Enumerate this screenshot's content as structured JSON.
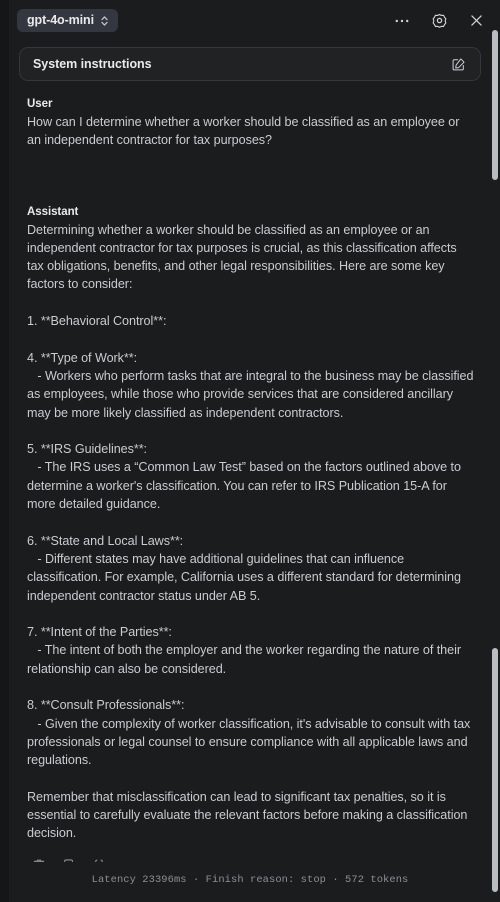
{
  "topbar": {
    "model": "gpt-4o-mini",
    "model_chip_icon": "chevron-updown-icon",
    "more_icon": "ellipsis-icon",
    "settings_icon": "gear-icon",
    "close_icon": "close-icon"
  },
  "system_instructions": {
    "label": "System instructions",
    "edit_icon": "edit-pencil-square-icon"
  },
  "conversation": {
    "user": {
      "role_label": "User",
      "text": "How can I determine whether a worker should be classified as an employee or an independent contractor for tax purposes?"
    },
    "assistant": {
      "role_label": "Assistant",
      "text": "Determining whether a worker should be classified as an employee or an independent contractor for tax purposes is crucial, as this classification affects tax obligations, benefits, and other legal responsibilities. Here are some key factors to consider:\n\n1. **Behavioral Control**:\n\n4. **Type of Work**:\n   - Workers who perform tasks that are integral to the business may be classified as employees, while those who provide services that are considered ancillary may be more likely classified as independent contractors.\n\n5. **IRS Guidelines**:\n   - The IRS uses a “Common Law Test” based on the factors outlined above to determine a worker's classification. You can refer to IRS Publication 15-A for more detailed guidance.\n\n6. **State and Local Laws**:\n   - Different states may have additional guidelines that can influence classification. For example, California uses a different standard for determining independent contractor status under AB 5.\n\n7. **Intent of the Parties**:\n   - The intent of both the employer and the worker regarding the nature of their relationship can also be considered.\n\n8. **Consult Professionals**:\n   - Given the complexity of worker classification, it's advisable to consult with tax professionals or legal counsel to ensure compliance with all applicable laws and regulations.\n\nRemember that misclassification can lead to significant tax penalties, so it is essential to carefully evaluate the relevant factors before making a classification decision.",
      "actions": [
        {
          "name": "delete-icon",
          "title": "Delete"
        },
        {
          "name": "thumbs-down-icon",
          "title": "Thumbs down"
        },
        {
          "name": "json-braces-icon",
          "title": "View code"
        }
      ]
    }
  },
  "footer": {
    "meta": "Latency 23396ms · Finish reason: stop · 572 tokens",
    "latency": "Latency 23396ms",
    "finish_reason": "Finish reason: stop",
    "tokens": "572 tokens"
  },
  "colors": {
    "background": "#1b1c1d",
    "chip_background": "#343740",
    "card_background": "#202224",
    "card_border": "#34373b",
    "text_primary": "#e9eaec",
    "text_body": "#c9ccd0",
    "text_muted": "#8b8f94",
    "scrollbar_thumb": "#b9bcc0"
  }
}
